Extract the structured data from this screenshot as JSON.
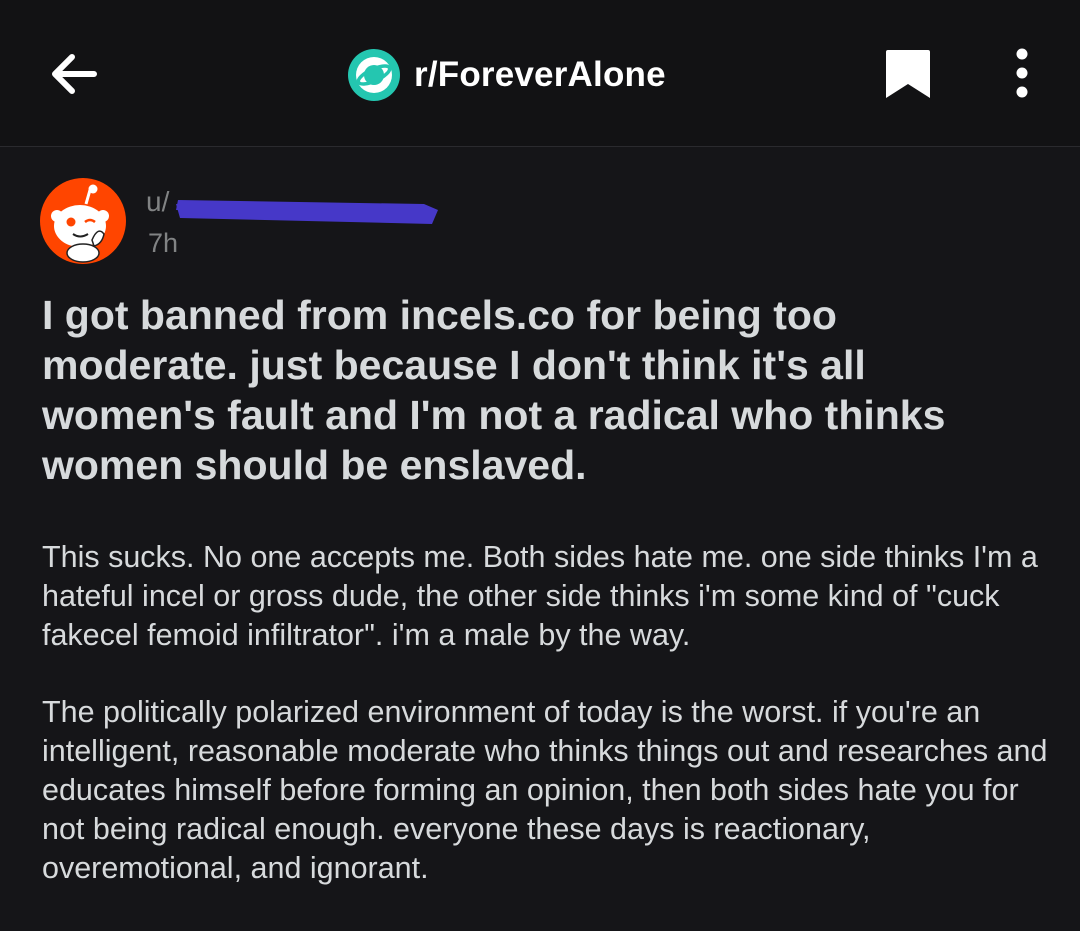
{
  "header": {
    "subreddit": "r/ForeverAlone",
    "icons": {
      "back": "arrow-left-icon",
      "subreddit": "planet-icon",
      "bookmark": "bookmark-icon",
      "more": "kebab-menu-icon"
    },
    "colors": {
      "background": "#121214",
      "subreddit_icon": "#24c6b0"
    }
  },
  "post": {
    "author_prefix": "u/",
    "author_redacted": "[redacted]",
    "age": "7h",
    "title": "I got banned from incels.co for being too moderate. just because I don't think it's all women's fault and I'm not a radical who thinks women should be enslaved.",
    "body": [
      "This sucks. No one accepts me. Both sides hate me. one side thinks I'm a hateful incel or gross dude, the other side thinks i'm some kind of \"cuck fakecel femoid infiltrator\". i'm a male by the way.",
      "The politically polarized environment of today is the worst. if you're an intelligent, reasonable moderate who thinks things out and researches and educates himself before forming an opinion, then both sides hate you for not being radical enough. everyone these days is reactionary, overemotional, and ignorant."
    ],
    "redaction_color": "#4638c8",
    "avatar_color": "#ff4500"
  }
}
